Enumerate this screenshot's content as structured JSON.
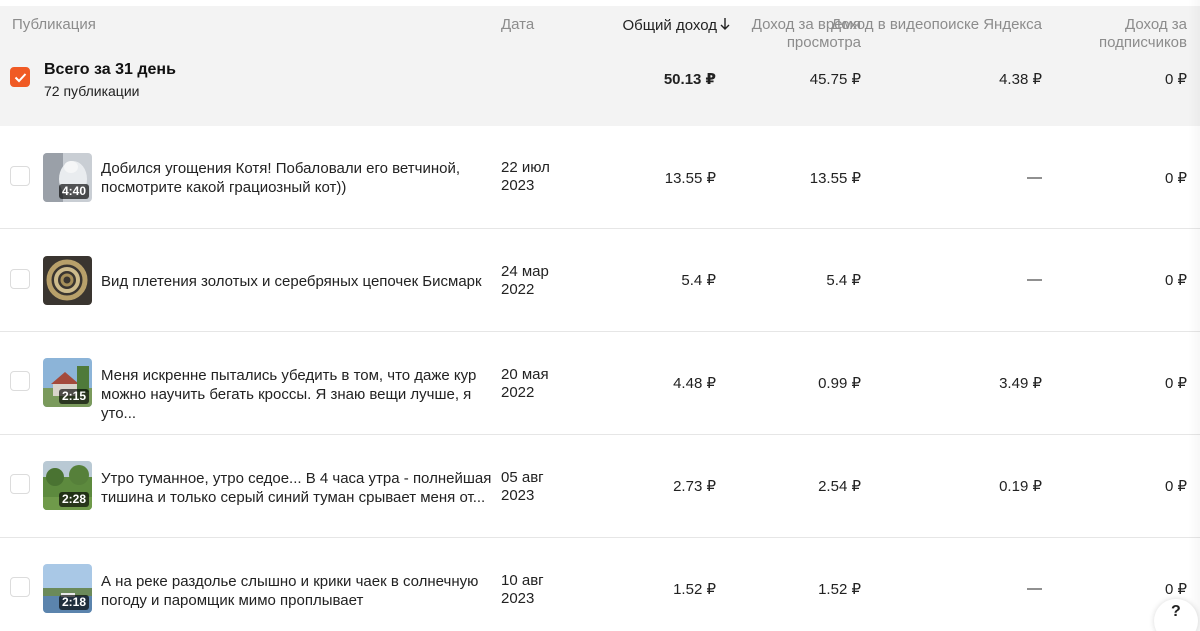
{
  "header": {
    "publication": "Публикация",
    "date": "Дата",
    "total_income": "Общий доход",
    "watch_income": "Доход за время просмотра",
    "search_income": "Доход в видеопоиске Яндекса",
    "subs_income": "Доход за подписчиков"
  },
  "summary": {
    "title": "Всего за 31 день",
    "subtitle": "72 публикации",
    "total": "50.13 ₽",
    "watch": "45.75 ₽",
    "search": "4.38 ₽",
    "subs": "0 ₽",
    "checked": true
  },
  "rows": [
    {
      "title": "Добился угощения Котя! Побаловали его ветчиной, посмотрите какой грациозный кот))",
      "date_line1": "22 июл",
      "date_line2": "2023",
      "duration": "4:40",
      "total": "13.55 ₽",
      "watch": "13.55 ₽",
      "search": "—",
      "subs": "0 ₽",
      "thumb": "cat"
    },
    {
      "title": "Вид плетения золотых и серебряных цепочек Бисмарк",
      "date_line1": "24 мар",
      "date_line2": "2022",
      "duration": "",
      "total": "5.4 ₽",
      "watch": "5.4 ₽",
      "search": "—",
      "subs": "0 ₽",
      "thumb": "chain"
    },
    {
      "title": "Меня искренне пытались убедить в том, что даже кур можно научить бегать кроссы. Я знаю вещи лучше, я уто...",
      "date_line1": "20 мая",
      "date_line2": "2022",
      "duration": "2:15",
      "total": "4.48 ₽",
      "watch": "0.99 ₽",
      "search": "3.49 ₽",
      "subs": "0 ₽",
      "thumb": "house"
    },
    {
      "title": "Утро туманное, утро седое... В 4 часа утра - полнейшая тишина и только серый синий туман срывает меня от...",
      "date_line1": "05 авг",
      "date_line2": "2023",
      "duration": "2:28",
      "total": "2.73 ₽",
      "watch": "2.54 ₽",
      "search": "0.19 ₽",
      "subs": "0 ₽",
      "thumb": "garden"
    },
    {
      "title": "А на реке раздолье слышно и крики чаек в солнечную погоду и паромщик мимо проплывает",
      "date_line1": "10 авг",
      "date_line2": "2023",
      "duration": "2:18",
      "total": "1.52 ₽",
      "watch": "1.52 ₽",
      "search": "—",
      "subs": "0 ₽",
      "thumb": "river"
    }
  ],
  "help_button": "?",
  "colors": {
    "accent": "#f05a24",
    "header_bg": "#f3f3f3",
    "muted_text": "#8c8c8c"
  }
}
